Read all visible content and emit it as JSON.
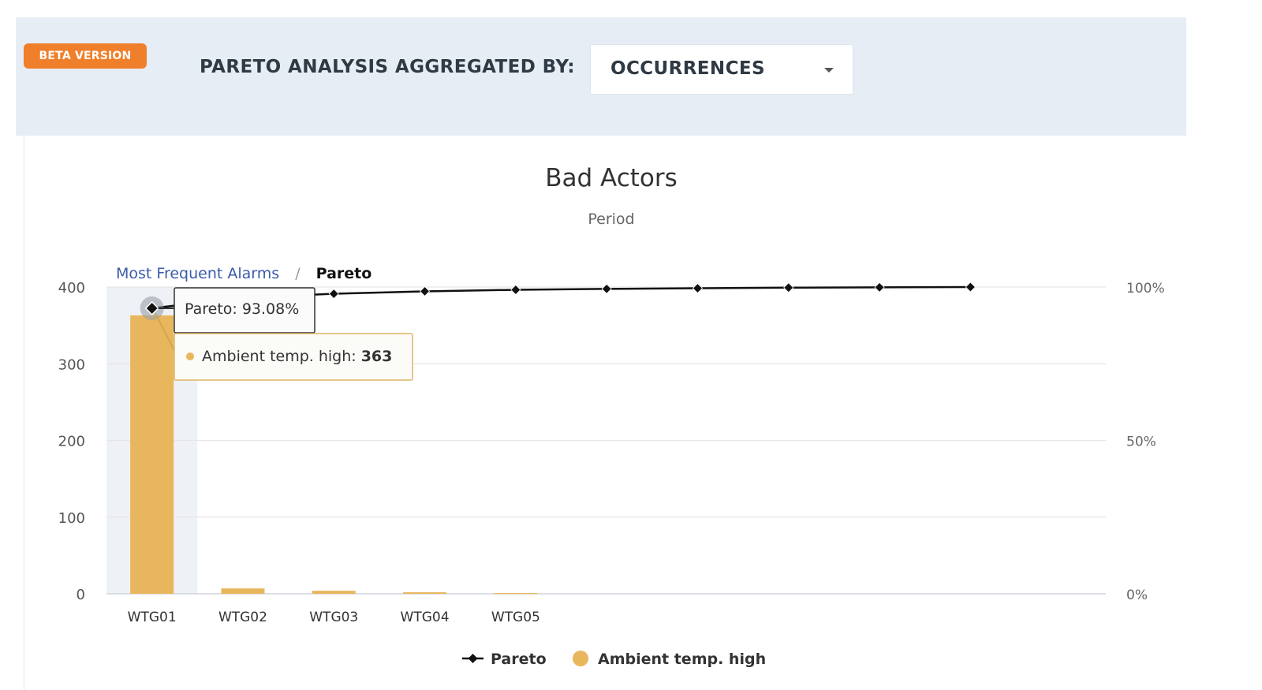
{
  "toolbar": {
    "beta_badge": "BETA VERSION",
    "aggregate_label": "PARETO ANALYSIS AGGREGATED BY:",
    "aggregate_value": "OCCURRENCES"
  },
  "breadcrumb": {
    "link": "Most Frequent Alarms",
    "separator": "/",
    "current": "Pareto"
  },
  "tooltip": {
    "pareto_label": "Pareto:",
    "pareto_value": "93.08%",
    "series_label": "Ambient temp. high:",
    "series_value": "363"
  },
  "chart_data": {
    "type": "bar",
    "title": "Bad Actors",
    "subtitle": "Period",
    "categories": [
      "WTG01",
      "WTG02",
      "WTG03",
      "WTG04",
      "WTG05"
    ],
    "series": [
      {
        "name": "Ambient temp. high",
        "type": "bar",
        "values": [
          363,
          7,
          4,
          2,
          1
        ],
        "color": "#e8b65c"
      }
    ],
    "pareto": {
      "name": "Pareto",
      "type": "line",
      "color": "#111111",
      "values": [
        93.08,
        96.5,
        97.8,
        98.6,
        99.1,
        99.4,
        99.6,
        99.8,
        99.9,
        100
      ]
    },
    "y_left": {
      "ticks": [
        "0",
        "100",
        "200",
        "300",
        "400"
      ],
      "range": [
        0,
        400
      ]
    },
    "y_right": {
      "ticks": [
        "0%",
        "50%",
        "100%"
      ],
      "range": [
        0,
        100
      ]
    },
    "highlight_color": "#eef1f5",
    "grid": true,
    "legend_position": "bottom-center"
  }
}
